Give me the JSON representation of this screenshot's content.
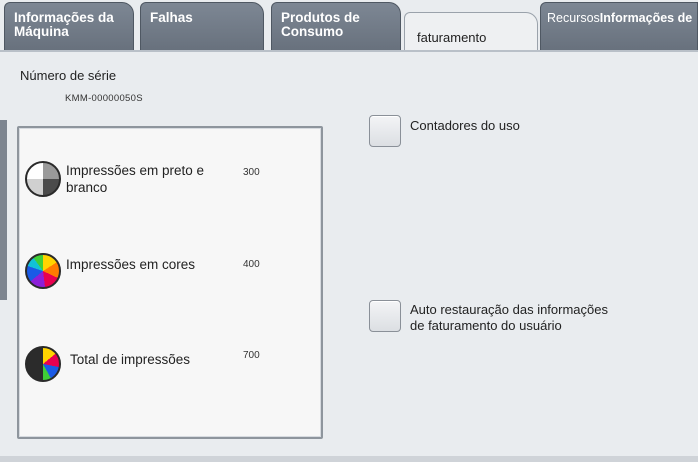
{
  "tabs": [
    {
      "label": "Informações da Máquina"
    },
    {
      "label": "Falhas"
    },
    {
      "label": "Produtos de Consumo"
    },
    {
      "label": "faturamento"
    },
    {
      "label": "Recursos",
      "label_extra": "Informações de"
    }
  ],
  "serial": {
    "label": "Número de série",
    "value": "KMM-00000050S"
  },
  "counters": [
    {
      "label": "Impressões em preto e branco",
      "value": "300",
      "icon": "black-white-print-icon"
    },
    {
      "label": "Impressões em cores",
      "value": "400",
      "icon": "color-print-icon"
    },
    {
      "label": "Total de impressões",
      "value": "700",
      "icon": "total-print-icon"
    }
  ],
  "actions": {
    "usage_counters": "Contadores do uso",
    "auto_restore": "Auto restauração das informações de faturamento do usuário"
  },
  "colors": {
    "tab_inactive": "#737c88",
    "tab_active": "#eef0f2",
    "background": "#e9ecef",
    "panel": "#f7f7f7"
  }
}
